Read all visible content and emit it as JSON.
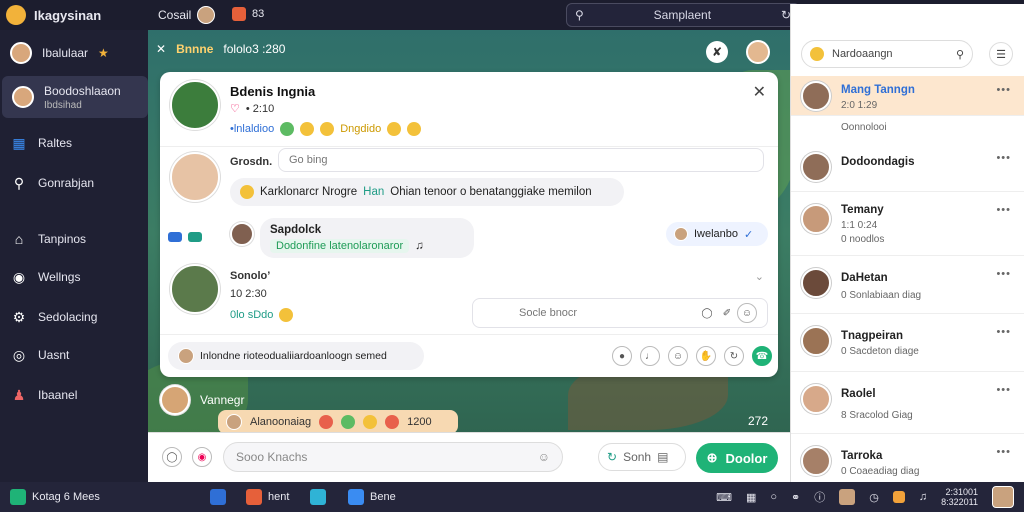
{
  "topbar": {
    "app_name": "Ikagysinan",
    "second_label": "Cosail",
    "third_label": "83",
    "search_placeholder": "Samplaent"
  },
  "sidebar": {
    "items": [
      {
        "label": "Ibalulaar",
        "icon": "avatar"
      },
      {
        "label": "Boodoshlaaon",
        "sub": "Ibdsihad",
        "icon": "avatar",
        "active": true
      },
      {
        "label": "Raltes",
        "icon": "grid-icon"
      },
      {
        "label": "Gonrabjan",
        "icon": "search-icon"
      },
      {
        "label": "Tanpinos",
        "icon": "home-icon"
      },
      {
        "label": "Wellngs",
        "icon": "chat-icon"
      },
      {
        "label": "Sedolacing",
        "icon": "settings-icon"
      },
      {
        "label": "Uasnt",
        "icon": "record-icon"
      },
      {
        "label": "Ibaanel",
        "icon": "people-icon"
      }
    ]
  },
  "main": {
    "top_title": "Bnnne",
    "top_sub": "fololo3 :280",
    "card": {
      "title": "Bdenis Ingnia",
      "line1": "• 2:10",
      "line2_link": "•lnlaldioo",
      "line2_rest": "Dngdido",
      "msg1_name": "Grosdn.",
      "msg1_placeholder": "Go bing",
      "msg1_text": "Karklonarcr Nrogre",
      "msg1_highlight": "Han",
      "msg1_tail": "Ohian tenoor o benatanggiake memilon",
      "msg2_name": "Sapdolck",
      "msg2_green": "Dodonfine latenolaronaror",
      "msg2_pill": "Iwelanbo",
      "msg3_name": "Sonolo’",
      "msg3_time": "10 2:30",
      "msg3_green": "0lo sDdo",
      "reply_placeholder": "Socle bnocr",
      "bottom_text": "Inlondne rioteodualiiardoanloogn semed"
    },
    "lower_name": "Vannegr",
    "emo_bar_label": "Alanoonaiag",
    "emo_bar_count": "1200",
    "right_count": "272",
    "composer": {
      "placeholder": "Sooo Knachs",
      "send_label": "Sonh",
      "done_label": "Doolor"
    }
  },
  "right": {
    "search_placeholder": "Nardoaangn",
    "contacts": [
      {
        "name": "Mang Tanngn",
        "sub": "2:0 1:29",
        "sub2": "Oonnolooi",
        "active": true
      },
      {
        "name": "Dodoondagis",
        "sub": ""
      },
      {
        "name": "Temany",
        "sub": "1:1 0:24",
        "sub2": "0 noodlos"
      },
      {
        "name": "DaHetan",
        "sub": "0 Sonlabiaan diag"
      },
      {
        "name": "Tnagpeiran",
        "sub": "0 Sacdeton diage"
      },
      {
        "name": "Raolel",
        "sub": "8 Sracolod Giag"
      },
      {
        "name": "Tarroka",
        "sub": "0 Coaeadiag diag"
      }
    ]
  },
  "taskbar": {
    "start_label": "Kotag 6 Mees",
    "app1": "hent",
    "app2": "Bene",
    "clock_time": "2:31001",
    "clock_date": "8:322011"
  }
}
